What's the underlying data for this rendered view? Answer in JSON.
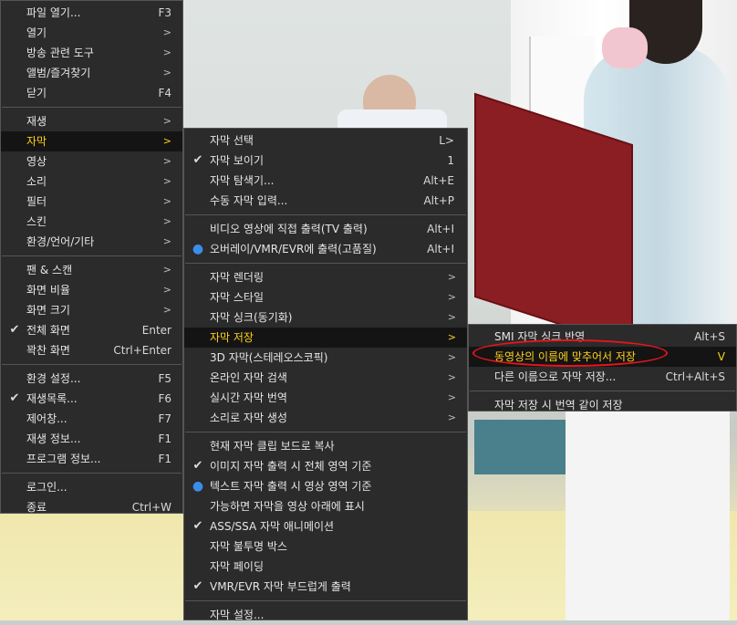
{
  "main_menu": [
    {
      "label": "파일 열기...",
      "shortcut": "F3"
    },
    {
      "label": "열기",
      "arrow": ">"
    },
    {
      "label": "방송 관련 도구",
      "arrow": ">"
    },
    {
      "label": "앨범/즐겨찾기",
      "arrow": ">"
    },
    {
      "label": "닫기",
      "shortcut": "F4"
    },
    {
      "label": "재생",
      "arrow": ">"
    },
    {
      "label": "자막",
      "arrow": ">"
    },
    {
      "label": "영상",
      "arrow": ">"
    },
    {
      "label": "소리",
      "arrow": ">"
    },
    {
      "label": "필터",
      "arrow": ">"
    },
    {
      "label": "스킨",
      "arrow": ">"
    },
    {
      "label": "환경/언어/기타",
      "arrow": ">"
    },
    {
      "label": "팬 & 스캔",
      "arrow": ">"
    },
    {
      "label": "화면 비율",
      "arrow": ">"
    },
    {
      "label": "화면 크기",
      "arrow": ">"
    },
    {
      "label": "전체 화면",
      "shortcut": "Enter"
    },
    {
      "label": "꽉찬 화면",
      "shortcut": "Ctrl+Enter"
    },
    {
      "label": "환경 설정...",
      "shortcut": "F5"
    },
    {
      "label": "재생목록...",
      "shortcut": "F6"
    },
    {
      "label": "제어창...",
      "shortcut": "F7"
    },
    {
      "label": "재생 정보...",
      "shortcut": "F1"
    },
    {
      "label": "프로그램 정보...",
      "shortcut": "F1"
    },
    {
      "label": "로그인..."
    },
    {
      "label": "종료",
      "shortcut": "Ctrl+W"
    }
  ],
  "subtitle_menu": [
    {
      "label": "자막 선택",
      "shortcut": "L>"
    },
    {
      "label": "자막 보이기",
      "shortcut": "1"
    },
    {
      "label": "자막 탐색기...",
      "shortcut": "Alt+E"
    },
    {
      "label": "수동 자막 입력...",
      "shortcut": "Alt+P"
    },
    {
      "label": "비디오 영상에 직접 출력(TV 출력)",
      "shortcut": "Alt+I"
    },
    {
      "label": "오버레이/VMR/EVR에 출력(고품질)",
      "shortcut": "Alt+I"
    },
    {
      "label": "자막 렌더링",
      "arrow": ">"
    },
    {
      "label": "자막 스타일",
      "arrow": ">"
    },
    {
      "label": "자막 싱크(동기화)",
      "arrow": ">"
    },
    {
      "label": "자막 저장",
      "arrow": ">"
    },
    {
      "label": "3D 자막(스테레오스코픽)",
      "arrow": ">"
    },
    {
      "label": "온라인 자막 검색",
      "arrow": ">"
    },
    {
      "label": "실시간 자막 번역",
      "arrow": ">"
    },
    {
      "label": "소리로 자막 생성",
      "arrow": ">"
    },
    {
      "label": "현재 자막 클립 보드로 복사"
    },
    {
      "label": "이미지 자막 출력 시 전체 영역 기준"
    },
    {
      "label": "텍스트 자막 출력 시 영상 영역 기준"
    },
    {
      "label": "가능하면 자막을 영상 아래에 표시"
    },
    {
      "label": "ASS/SSA 자막 애니메이션"
    },
    {
      "label": "자막 불투명 박스"
    },
    {
      "label": "자막 페이딩"
    },
    {
      "label": "VMR/EVR 자막 부드럽게 출력"
    },
    {
      "label": "자막 설정..."
    }
  ],
  "save_menu": [
    {
      "label": "SMI 자막 싱크 반영",
      "shortcut": "Alt+S"
    },
    {
      "label": "동영상의 이름에 맞추어서 저장",
      "shortcut": "V"
    },
    {
      "label": "다른 이름으로 자막 저장...",
      "shortcut": "Ctrl+Alt+S"
    },
    {
      "label": "자막 저장 시 번역 같이 저장"
    }
  ],
  "colors": {
    "highlight_text": "#ffd21a",
    "highlight_bg": "#141414",
    "menu_bg": "#2b2b2b",
    "radio_dot": "#3a8ee8",
    "annotation": "#e8141a"
  },
  "icons": {
    "check": "check-icon",
    "radio": "radio-dot-icon",
    "submenu": "chevron-right-icon"
  }
}
